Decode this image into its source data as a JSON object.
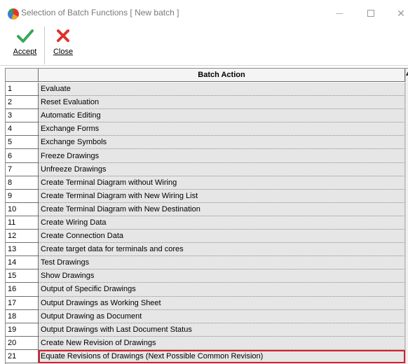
{
  "window": {
    "title": "Selection of Batch Functions [ New batch ]",
    "minimize_glyph": "—",
    "maximize_glyph": "☐",
    "close_glyph": "✕",
    "app_icon": "colorful-globe-icon"
  },
  "toolbar": {
    "accept_label": "Accept",
    "close_label": "Close",
    "accept_icon": "checkmark-icon",
    "close_icon": "x-icon",
    "accept_color": "#3aa655",
    "close_color": "#e0322b"
  },
  "table": {
    "header": {
      "number": "",
      "action": "Batch Action"
    },
    "selected_row": 21,
    "selection_color": "#d4202a",
    "rows": [
      {
        "num": "1",
        "action": "Evaluate"
      },
      {
        "num": "2",
        "action": "Reset Evaluation"
      },
      {
        "num": "3",
        "action": "Automatic Editing"
      },
      {
        "num": "4",
        "action": "Exchange Forms"
      },
      {
        "num": "5",
        "action": "Exchange Symbols"
      },
      {
        "num": "6",
        "action": "Freeze Drawings"
      },
      {
        "num": "7",
        "action": "Unfreeze Drawings"
      },
      {
        "num": "8",
        "action": "Create Terminal Diagram without Wiring"
      },
      {
        "num": "9",
        "action": "Create Terminal Diagram with New Wiring List"
      },
      {
        "num": "10",
        "action": "Create Terminal Diagram with New Destination"
      },
      {
        "num": "11",
        "action": "Create Wiring Data"
      },
      {
        "num": "12",
        "action": "Create Connection Data"
      },
      {
        "num": "13",
        "action": "Create target data for terminals and cores"
      },
      {
        "num": "14",
        "action": "Test Drawings"
      },
      {
        "num": "15",
        "action": "Show Drawings"
      },
      {
        "num": "16",
        "action": "Output of Specific Drawings"
      },
      {
        "num": "17",
        "action": "Output Drawings as Working Sheet"
      },
      {
        "num": "18",
        "action": "Output Drawing as Document"
      },
      {
        "num": "19",
        "action": "Output Drawings with Last Document Status"
      },
      {
        "num": "20",
        "action": "Create New Revision of Drawings"
      },
      {
        "num": "21",
        "action": "Equate Revisions of Drawings (Next Possible Common Revision)"
      }
    ]
  }
}
